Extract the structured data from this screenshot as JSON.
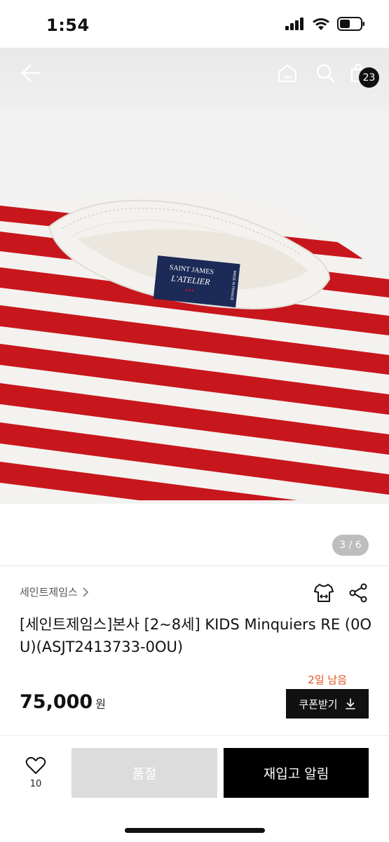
{
  "status_bar": {
    "time": "1:54"
  },
  "nav": {
    "cart_count": "23"
  },
  "image": {
    "label_line1": "SAINT JAMES",
    "label_line2": "L'ATELIER",
    "label_side": "MADE IN FRANCE",
    "page_indicator": "3 / 6",
    "colors": {
      "stripe": "#c8161d",
      "fabric": "#f4f2ee",
      "label": "#1c2a57"
    }
  },
  "product": {
    "brand": "세인트제임스",
    "title": "[세인트제임스]본사 [2~8세] KIDS Minquiers RE (0OU)(ASJT2413733-0OU)",
    "days_left": "2일 남음",
    "price": "75,000",
    "currency": "원",
    "coupon_label": "쿠폰받기"
  },
  "bottom": {
    "wish_count": "10",
    "soldout_label": "품절",
    "restock_label": "재입고 알림"
  }
}
